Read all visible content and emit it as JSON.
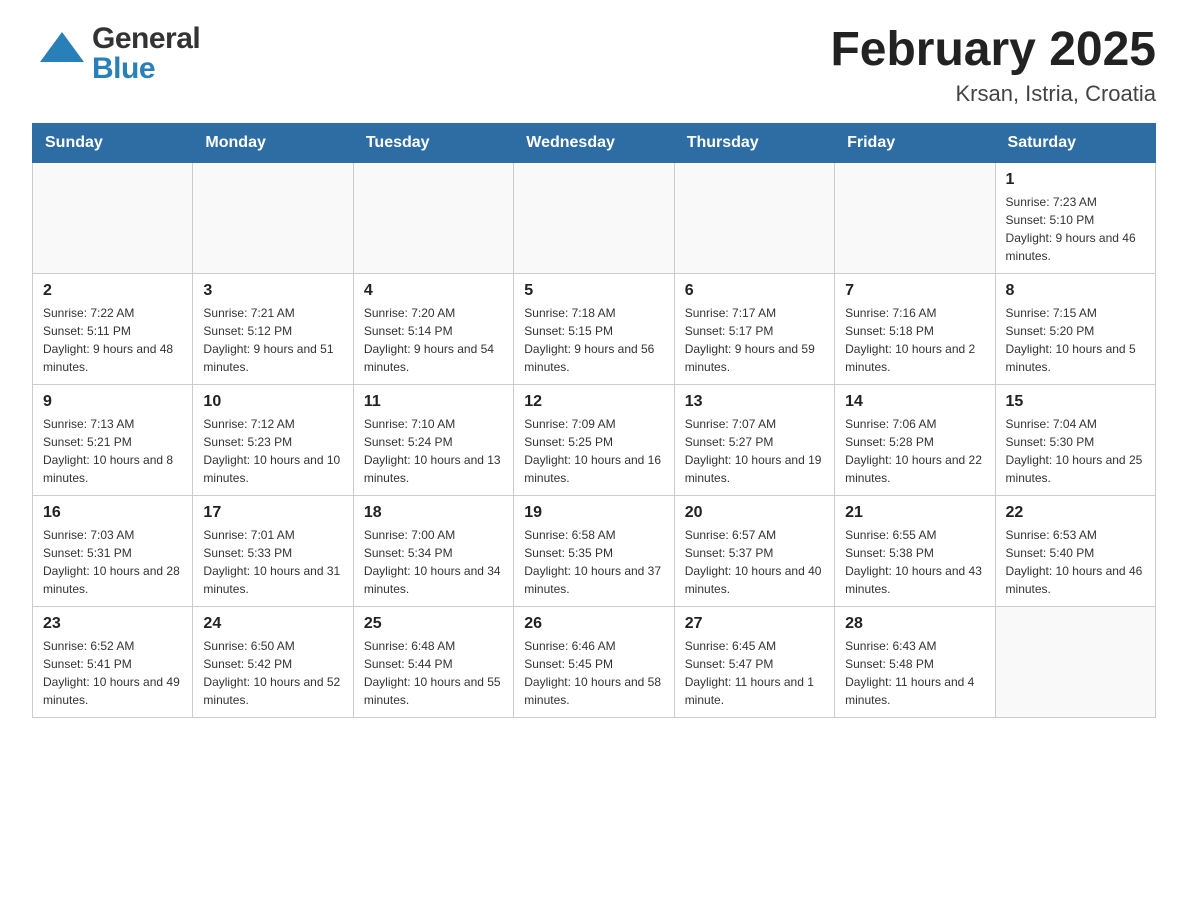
{
  "header": {
    "title": "February 2025",
    "subtitle": "Krsan, Istria, Croatia",
    "logo_general": "General",
    "logo_blue": "Blue"
  },
  "weekdays": [
    "Sunday",
    "Monday",
    "Tuesday",
    "Wednesday",
    "Thursday",
    "Friday",
    "Saturday"
  ],
  "weeks": [
    [
      {
        "day": "",
        "info": ""
      },
      {
        "day": "",
        "info": ""
      },
      {
        "day": "",
        "info": ""
      },
      {
        "day": "",
        "info": ""
      },
      {
        "day": "",
        "info": ""
      },
      {
        "day": "",
        "info": ""
      },
      {
        "day": "1",
        "info": "Sunrise: 7:23 AM\nSunset: 5:10 PM\nDaylight: 9 hours and 46 minutes."
      }
    ],
    [
      {
        "day": "2",
        "info": "Sunrise: 7:22 AM\nSunset: 5:11 PM\nDaylight: 9 hours and 48 minutes."
      },
      {
        "day": "3",
        "info": "Sunrise: 7:21 AM\nSunset: 5:12 PM\nDaylight: 9 hours and 51 minutes."
      },
      {
        "day": "4",
        "info": "Sunrise: 7:20 AM\nSunset: 5:14 PM\nDaylight: 9 hours and 54 minutes."
      },
      {
        "day": "5",
        "info": "Sunrise: 7:18 AM\nSunset: 5:15 PM\nDaylight: 9 hours and 56 minutes."
      },
      {
        "day": "6",
        "info": "Sunrise: 7:17 AM\nSunset: 5:17 PM\nDaylight: 9 hours and 59 minutes."
      },
      {
        "day": "7",
        "info": "Sunrise: 7:16 AM\nSunset: 5:18 PM\nDaylight: 10 hours and 2 minutes."
      },
      {
        "day": "8",
        "info": "Sunrise: 7:15 AM\nSunset: 5:20 PM\nDaylight: 10 hours and 5 minutes."
      }
    ],
    [
      {
        "day": "9",
        "info": "Sunrise: 7:13 AM\nSunset: 5:21 PM\nDaylight: 10 hours and 8 minutes."
      },
      {
        "day": "10",
        "info": "Sunrise: 7:12 AM\nSunset: 5:23 PM\nDaylight: 10 hours and 10 minutes."
      },
      {
        "day": "11",
        "info": "Sunrise: 7:10 AM\nSunset: 5:24 PM\nDaylight: 10 hours and 13 minutes."
      },
      {
        "day": "12",
        "info": "Sunrise: 7:09 AM\nSunset: 5:25 PM\nDaylight: 10 hours and 16 minutes."
      },
      {
        "day": "13",
        "info": "Sunrise: 7:07 AM\nSunset: 5:27 PM\nDaylight: 10 hours and 19 minutes."
      },
      {
        "day": "14",
        "info": "Sunrise: 7:06 AM\nSunset: 5:28 PM\nDaylight: 10 hours and 22 minutes."
      },
      {
        "day": "15",
        "info": "Sunrise: 7:04 AM\nSunset: 5:30 PM\nDaylight: 10 hours and 25 minutes."
      }
    ],
    [
      {
        "day": "16",
        "info": "Sunrise: 7:03 AM\nSunset: 5:31 PM\nDaylight: 10 hours and 28 minutes."
      },
      {
        "day": "17",
        "info": "Sunrise: 7:01 AM\nSunset: 5:33 PM\nDaylight: 10 hours and 31 minutes."
      },
      {
        "day": "18",
        "info": "Sunrise: 7:00 AM\nSunset: 5:34 PM\nDaylight: 10 hours and 34 minutes."
      },
      {
        "day": "19",
        "info": "Sunrise: 6:58 AM\nSunset: 5:35 PM\nDaylight: 10 hours and 37 minutes."
      },
      {
        "day": "20",
        "info": "Sunrise: 6:57 AM\nSunset: 5:37 PM\nDaylight: 10 hours and 40 minutes."
      },
      {
        "day": "21",
        "info": "Sunrise: 6:55 AM\nSunset: 5:38 PM\nDaylight: 10 hours and 43 minutes."
      },
      {
        "day": "22",
        "info": "Sunrise: 6:53 AM\nSunset: 5:40 PM\nDaylight: 10 hours and 46 minutes."
      }
    ],
    [
      {
        "day": "23",
        "info": "Sunrise: 6:52 AM\nSunset: 5:41 PM\nDaylight: 10 hours and 49 minutes."
      },
      {
        "day": "24",
        "info": "Sunrise: 6:50 AM\nSunset: 5:42 PM\nDaylight: 10 hours and 52 minutes."
      },
      {
        "day": "25",
        "info": "Sunrise: 6:48 AM\nSunset: 5:44 PM\nDaylight: 10 hours and 55 minutes."
      },
      {
        "day": "26",
        "info": "Sunrise: 6:46 AM\nSunset: 5:45 PM\nDaylight: 10 hours and 58 minutes."
      },
      {
        "day": "27",
        "info": "Sunrise: 6:45 AM\nSunset: 5:47 PM\nDaylight: 11 hours and 1 minute."
      },
      {
        "day": "28",
        "info": "Sunrise: 6:43 AM\nSunset: 5:48 PM\nDaylight: 11 hours and 4 minutes."
      },
      {
        "day": "",
        "info": ""
      }
    ]
  ]
}
